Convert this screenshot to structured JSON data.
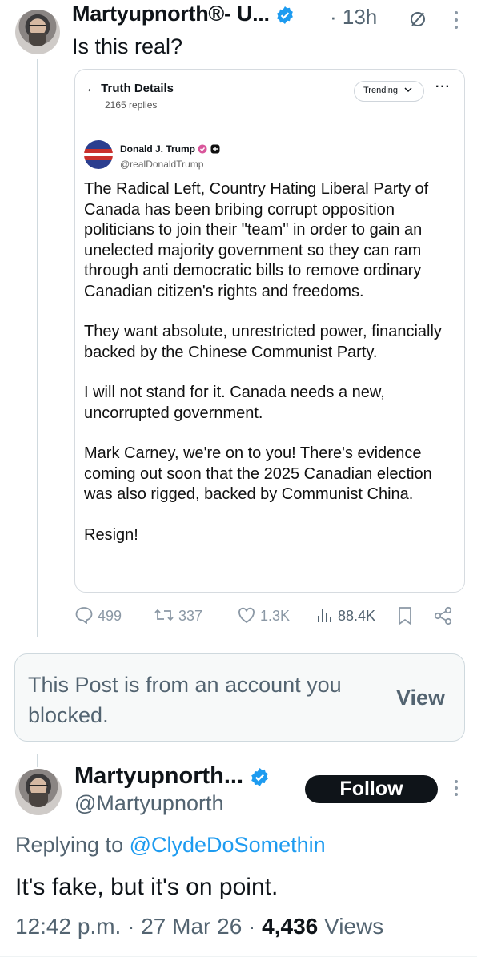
{
  "post1": {
    "author": "Martyupnorth®- U...",
    "time": "13h",
    "text": "Is this real?"
  },
  "quoted": {
    "title": "Truth Details",
    "replies": "2165 replies",
    "sort_label": "Trending",
    "author_name": "Donald J. Trump",
    "author_handle": "@realDonaldTrump",
    "paragraphs": [
      "The Radical Left, Country Hating Liberal Party of Canada has been bribing corrupt opposition politicians to join their \"team\" in order to gain an unelected majority government so they can ram through anti democratic bills to remove ordinary Canadian citizen's rights and freedoms.",
      "They want absolute, unrestricted power, financially backed by the Chinese Communist Party.",
      "I will not stand for it. Canada needs a new, uncorrupted government.",
      "Mark Carney, we're on to you! There's evidence coming out soon that the 2025 Canadian election was also rigged, backed by Communist China.",
      "Resign!"
    ]
  },
  "metrics": {
    "replies": "499",
    "reposts": "337",
    "likes": "1.3K",
    "views": "88.4K"
  },
  "blocked": {
    "text": "This Post is from an account you blocked.",
    "view_label": "View"
  },
  "post2": {
    "author": "Martyupnorth...",
    "handle": "@Martyupnorth",
    "follow_label": "Follow",
    "replying_prefix": "Replying to",
    "replying_to": "@ClydeDoSomethin",
    "text": "It's fake, but it's on point.",
    "time": "12:42 p.m.",
    "date": "27 Mar 26",
    "views_count": "4,436",
    "views_label": "Views"
  },
  "colors": {
    "accent": "#1d9bf0",
    "muted": "#536471",
    "text": "#0f1419"
  }
}
